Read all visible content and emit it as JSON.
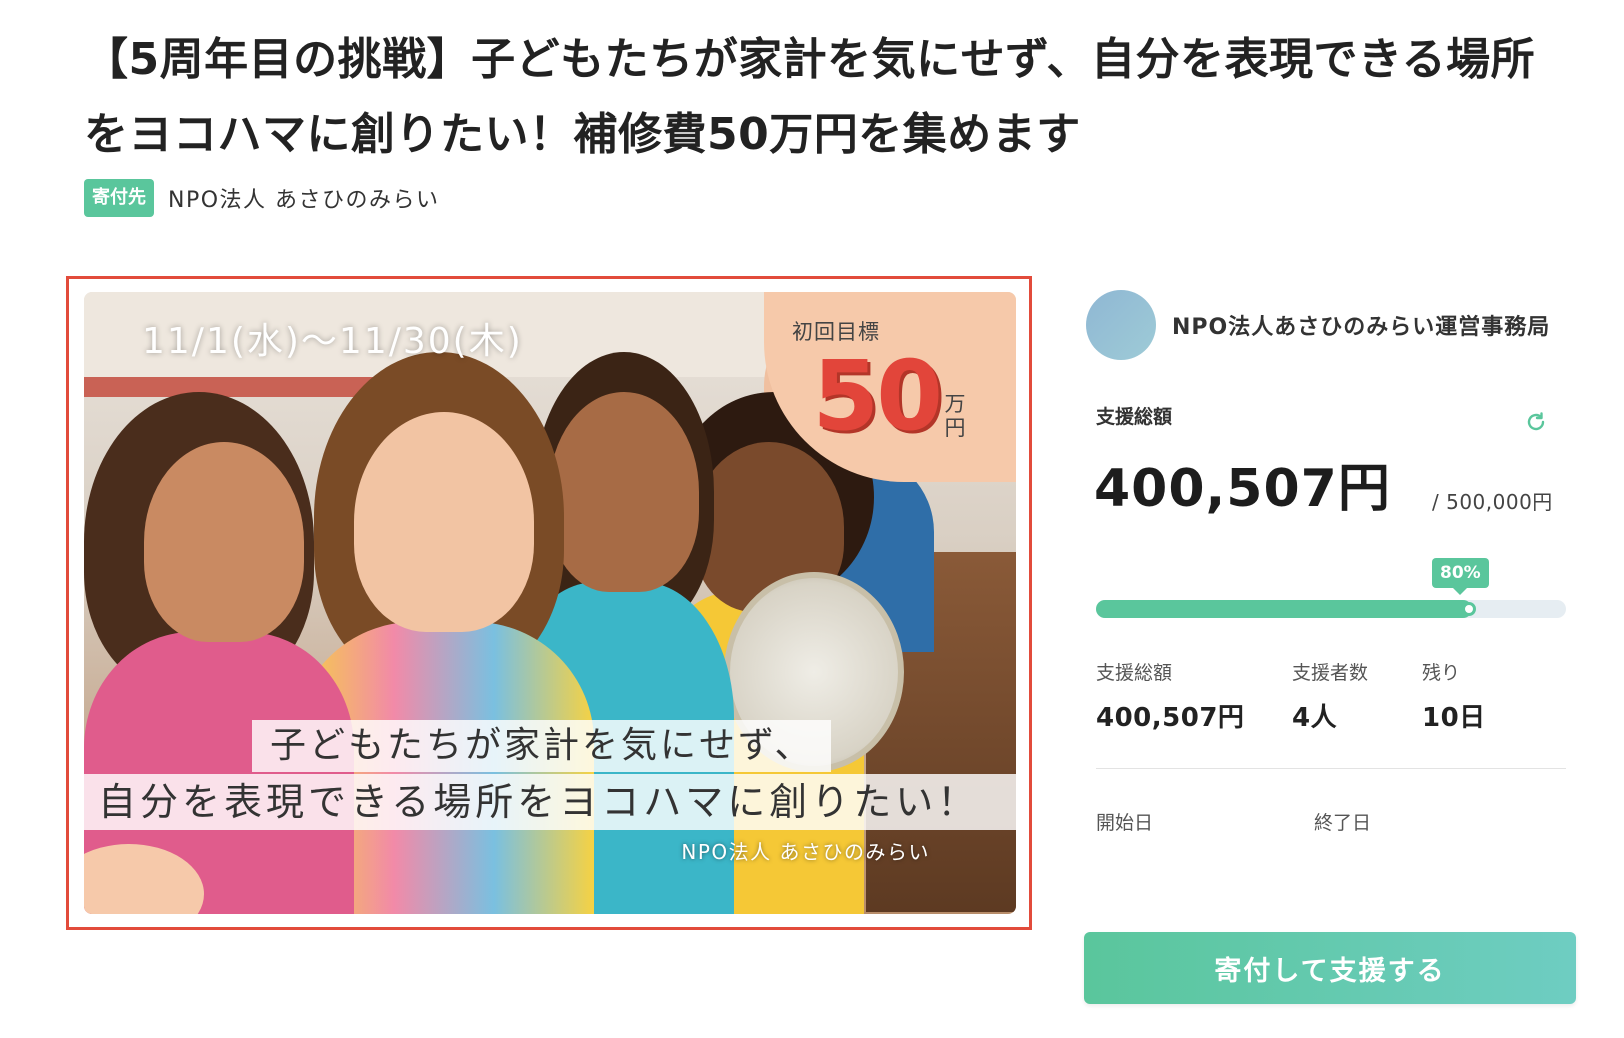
{
  "title": "【5周年目の挑戦】子どもたちが家計を気にせず、自分を表現できる場所をヨコハマに創りたい！補修費50万円を集めます",
  "org": {
    "badge": "寄付先",
    "name": "NPO法人 あさひのみらい"
  },
  "hero": {
    "date_range": "11/1(水)〜11/30(木)",
    "goal_label": "初回目標",
    "goal_number": "50",
    "goal_unit": "万円",
    "tagline_1": "子どもたちが家計を気にせず、",
    "tagline_2": "自分を表現できる場所をヨコハマに創りたい！",
    "org_name": "NPO法人 あさひのみらい"
  },
  "panel": {
    "owner_name": "NPO法人あさひのみらい運営事務局",
    "total_label": "支援総額",
    "total_value": "400,507円",
    "goal_value": "/ 500,000円",
    "progress_percent": 80,
    "progress_label": "80%",
    "stats": [
      {
        "label": "支援総額",
        "value": "400,507円"
      },
      {
        "label": "支援者数",
        "value": "4人"
      },
      {
        "label": "残り",
        "value": "10日"
      }
    ],
    "start_label": "開始日",
    "end_label": "終了日",
    "donate_button": "寄付して支援する"
  },
  "colors": {
    "accent": "#5ac69c",
    "highlight_border": "#e24b3b",
    "goal_red": "#e2453a"
  },
  "icons": {
    "refresh": "refresh-icon"
  }
}
